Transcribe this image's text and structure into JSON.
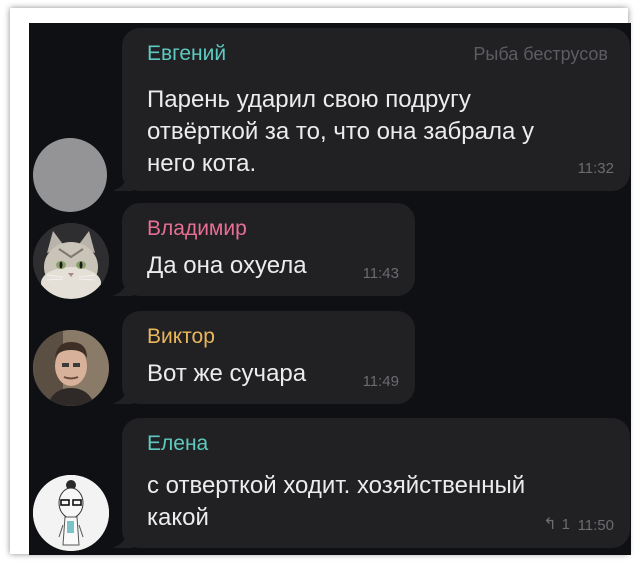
{
  "messages": [
    {
      "sender": "Евгений",
      "sender_color": "#5ec9c0",
      "forwarded_from": "Рыба беструсов",
      "text_lines": [
        "Парень ударил свою подругу",
        "отвёрткой за то, что она забрала у",
        "него кота."
      ],
      "time": "11:32",
      "avatar": "grey-circle"
    },
    {
      "sender": "Владимир",
      "sender_color": "#e66f93",
      "text": "Да она охуела",
      "time": "11:43",
      "avatar": "cat-avatar"
    },
    {
      "sender": "Виктор",
      "sender_color": "#e9b75a",
      "text": "Вот же сучара",
      "time": "11:49",
      "avatar": "man-avatar"
    },
    {
      "sender": "Елена",
      "sender_color": "#5ec9c0",
      "text_lines": [
        "с отверткой ходит. хозяйственный",
        "какой"
      ],
      "reply_icon": "reply-arrow-icon",
      "reply_count": "1",
      "time": "11:50",
      "avatar": "woman-sketch-avatar"
    }
  ]
}
